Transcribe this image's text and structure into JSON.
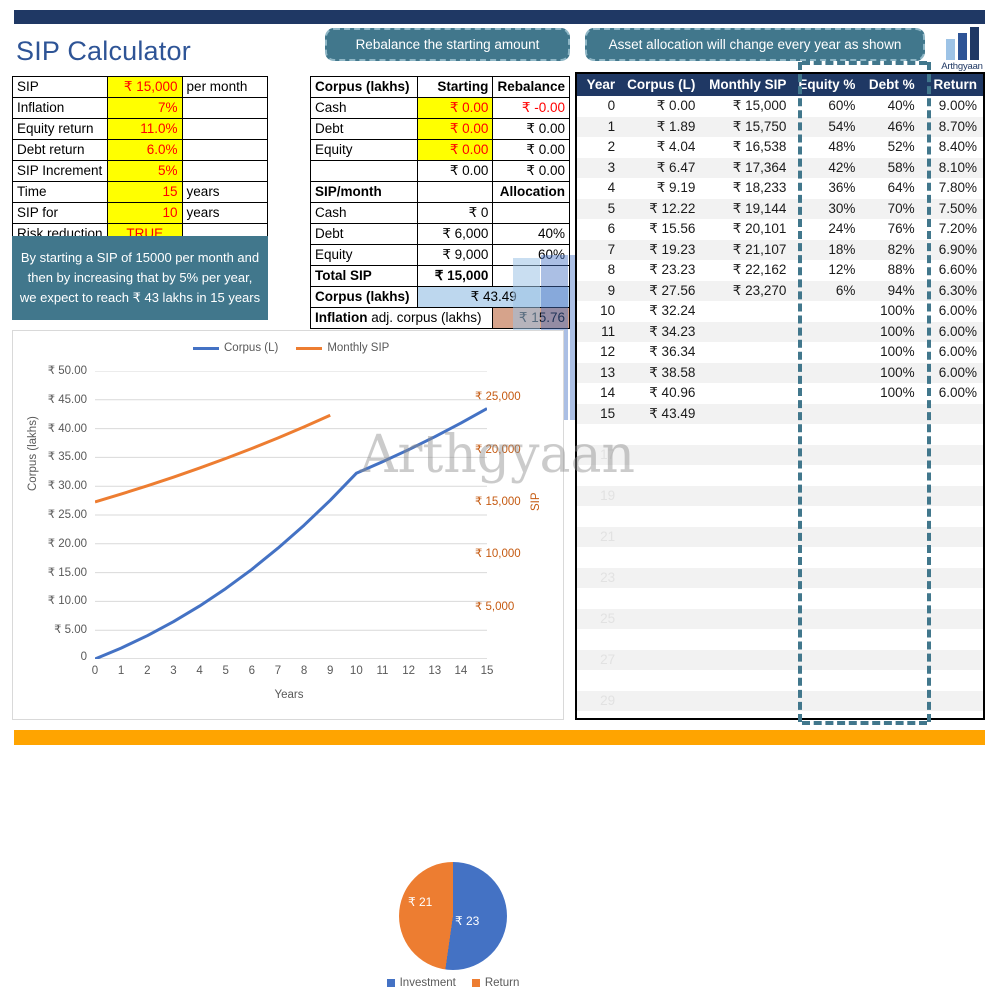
{
  "page_title": "SIP Calculator",
  "brand": {
    "name": "Arthgyaan",
    "watermark": "Arthgyaan"
  },
  "colors": {
    "navy": "#1f3864",
    "title_blue": "#2e5496",
    "pill_teal": "#41778c",
    "accent_orange": "#ffa400",
    "highlight_yellow": "#ffff00",
    "input_red": "#ff0000",
    "series_corpus": "#4472c4",
    "series_sip": "#ed7d31"
  },
  "pills": {
    "rebalance": "Rebalance the starting amount",
    "allocation": "Asset allocation will change every year as shown"
  },
  "inputs": {
    "rows": [
      {
        "label": "SIP",
        "value": "₹ 15,000",
        "unit": "per month",
        "align": "right"
      },
      {
        "label": "Inflation",
        "value": "7%",
        "unit": "",
        "align": "right"
      },
      {
        "label": "Equity return",
        "value": "11.0%",
        "unit": "",
        "align": "right"
      },
      {
        "label": "Debt return",
        "value": "6.0%",
        "unit": "",
        "align": "right"
      },
      {
        "label": "SIP Increment",
        "value": "5%",
        "unit": "",
        "align": "right"
      },
      {
        "label": "Time",
        "value": "15",
        "unit": "years",
        "align": "right"
      },
      {
        "label": "SIP for",
        "value": "10",
        "unit": "years",
        "align": "right"
      },
      {
        "label": "Risk reduction",
        "value": "TRUE",
        "unit": "",
        "align": "center"
      }
    ]
  },
  "callout": "By starting a SIP of 15000 per month and then by increasing that by 5% per year, we expect to reach ₹ 43 lakhs in 15 years",
  "corpus_table": {
    "header": {
      "c0": "Corpus (lakhs)",
      "c1": "Starting",
      "c2": "Rebalance"
    },
    "rows": [
      {
        "c0": "Cash",
        "c1": "₹ 0.00",
        "c2": "₹ -0.00",
        "c1_style": "yellow",
        "c2_style": "red"
      },
      {
        "c0": "Debt",
        "c1": "₹ 0.00",
        "c2": "₹ 0.00",
        "c1_style": "yellow",
        "c2_style": ""
      },
      {
        "c0": "Equity",
        "c1": "₹ 0.00",
        "c2": "₹ 0.00",
        "c1_style": "yellow",
        "c2_style": ""
      },
      {
        "c0": "",
        "c1": "₹ 0.00",
        "c2": "₹ 0.00",
        "c1_style": "",
        "c2_style": ""
      }
    ],
    "sip_header": {
      "c0": "SIP/month",
      "c1": "",
      "c2": "Allocation"
    },
    "sip_rows": [
      {
        "c0": "Cash",
        "c1": "₹ 0",
        "c2": ""
      },
      {
        "c0": "Debt",
        "c1": "₹ 6,000",
        "c2": "40%"
      },
      {
        "c0": "Equity",
        "c1": "₹ 9,000",
        "c2": "60%"
      },
      {
        "c0": "Total SIP",
        "c1": "₹ 15,000",
        "c2": ""
      }
    ],
    "corpus_row": {
      "label": "Corpus (lakhs)",
      "value": "₹ 43.49"
    },
    "inflation_row": {
      "label_bold": "Inflation",
      "label_rest": " adj. corpus (lakhs)",
      "value": "₹ 15.76"
    }
  },
  "projection": {
    "columns": [
      "Year",
      "Corpus (L)",
      "Monthly SIP",
      "Equity %",
      "Debt %",
      "Return"
    ],
    "rows": [
      [
        "0",
        "₹ 0.00",
        "₹ 15,000",
        "60%",
        "40%",
        "9.00%"
      ],
      [
        "1",
        "₹ 1.89",
        "₹ 15,750",
        "54%",
        "46%",
        "8.70%"
      ],
      [
        "2",
        "₹ 4.04",
        "₹ 16,538",
        "48%",
        "52%",
        "8.40%"
      ],
      [
        "3",
        "₹ 6.47",
        "₹ 17,364",
        "42%",
        "58%",
        "8.10%"
      ],
      [
        "4",
        "₹ 9.19",
        "₹ 18,233",
        "36%",
        "64%",
        "7.80%"
      ],
      [
        "5",
        "₹ 12.22",
        "₹ 19,144",
        "30%",
        "70%",
        "7.50%"
      ],
      [
        "6",
        "₹ 15.56",
        "₹ 20,101",
        "24%",
        "76%",
        "7.20%"
      ],
      [
        "7",
        "₹ 19.23",
        "₹ 21,107",
        "18%",
        "82%",
        "6.90%"
      ],
      [
        "8",
        "₹ 23.23",
        "₹ 22,162",
        "12%",
        "88%",
        "6.60%"
      ],
      [
        "9",
        "₹ 27.56",
        "₹ 23,270",
        "6%",
        "94%",
        "6.30%"
      ],
      [
        "10",
        "₹ 32.24",
        "",
        "",
        "100%",
        "6.00%"
      ],
      [
        "11",
        "₹ 34.23",
        "",
        "",
        "100%",
        "6.00%"
      ],
      [
        "12",
        "₹ 36.34",
        "",
        "",
        "100%",
        "6.00%"
      ],
      [
        "13",
        "₹ 38.58",
        "",
        "",
        "100%",
        "6.00%"
      ],
      [
        "14",
        "₹ 40.96",
        "",
        "",
        "100%",
        "6.00%"
      ],
      [
        "15",
        "₹ 43.49",
        "",
        "",
        "",
        ""
      ]
    ],
    "ghost_rows": [
      [
        "",
        "",
        "",
        "",
        "",
        ""
      ],
      [
        "17",
        "",
        "",
        "",
        "",
        ""
      ],
      [
        "",
        "",
        "",
        "",
        "",
        ""
      ],
      [
        "19",
        "",
        "",
        "",
        "",
        ""
      ],
      [
        "",
        "",
        "",
        "",
        "",
        ""
      ],
      [
        "21",
        "",
        "",
        "",
        "",
        ""
      ],
      [
        "",
        "",
        "",
        "",
        "",
        ""
      ],
      [
        "23",
        "",
        "",
        "",
        "",
        ""
      ],
      [
        "",
        "",
        "",
        "",
        "",
        ""
      ],
      [
        "25",
        "",
        "",
        "",
        "",
        ""
      ],
      [
        "",
        "",
        "",
        "",
        "",
        ""
      ],
      [
        "27",
        "",
        "",
        "",
        "",
        ""
      ],
      [
        "",
        "",
        "",
        "",
        "",
        ""
      ],
      [
        "29",
        "",
        "",
        "",
        "",
        ""
      ]
    ]
  },
  "chart_data": [
    {
      "type": "line",
      "title": "",
      "xlabel": "Years",
      "ylabel": "Corpus (lakhs)",
      "ylabel_secondary": "SIP",
      "x": [
        0,
        1,
        2,
        3,
        4,
        5,
        6,
        7,
        8,
        9,
        10,
        11,
        12,
        13,
        14,
        15
      ],
      "xticks": [
        "0",
        "1",
        "2",
        "3",
        "4",
        "5",
        "6",
        "7",
        "8",
        "9",
        "10",
        "11",
        "12",
        "13",
        "14",
        "15"
      ],
      "yticks": [
        "0",
        "₹ 5.00",
        "₹ 10.00",
        "₹ 15.00",
        "₹ 20.00",
        "₹ 25.00",
        "₹ 30.00",
        "₹ 35.00",
        "₹ 40.00",
        "₹ 45.00",
        "₹ 50.00"
      ],
      "ylim": [
        0,
        50
      ],
      "yticks_secondary": [
        "₹ 5,000",
        "₹ 10,000",
        "₹ 15,000",
        "₹ 20,000",
        "₹ 25,000"
      ],
      "ylim_secondary": [
        0,
        27500
      ],
      "grid": true,
      "legend_position": "top",
      "series": [
        {
          "name": "Corpus (L)",
          "color": "#4472c4",
          "axis": "left",
          "values": [
            0,
            1.89,
            4.04,
            6.47,
            9.19,
            12.22,
            15.56,
            19.23,
            23.23,
            27.56,
            32.24,
            34.23,
            36.34,
            38.58,
            40.96,
            43.49
          ]
        },
        {
          "name": "Monthly SIP",
          "color": "#ed7d31",
          "axis": "right",
          "values": [
            15000,
            15750,
            16538,
            17364,
            18233,
            19144,
            20101,
            21107,
            22162,
            23270,
            null,
            null,
            null,
            null,
            null,
            null
          ]
        }
      ]
    },
    {
      "type": "pie",
      "title": "",
      "labels": [
        "Investment",
        "Return"
      ],
      "values": [
        23,
        21
      ],
      "data_labels": [
        "₹ 23",
        "₹ 21"
      ],
      "colors": [
        "#4472c4",
        "#ed7d31"
      ],
      "legend_position": "bottom"
    }
  ]
}
